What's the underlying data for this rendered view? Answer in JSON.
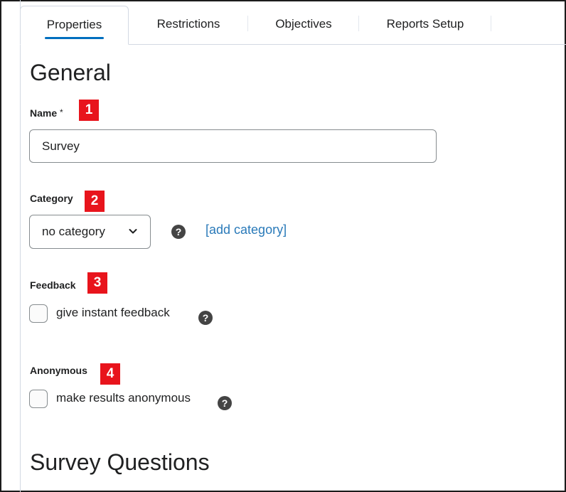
{
  "tabs": [
    {
      "label": "Properties",
      "active": true
    },
    {
      "label": "Restrictions",
      "active": false
    },
    {
      "label": "Objectives",
      "active": false
    },
    {
      "label": "Reports Setup",
      "active": false
    }
  ],
  "general": {
    "heading": "General",
    "name": {
      "label": "Name",
      "required_mark": "*",
      "marker": "1",
      "value": "Survey"
    },
    "category": {
      "label": "Category",
      "marker": "2",
      "selected": "no category",
      "help_icon": "?",
      "add_link": "[add category]"
    },
    "feedback": {
      "label": "Feedback",
      "marker": "3",
      "checkbox_label": "give instant feedback",
      "checked": false,
      "help_icon": "?"
    },
    "anonymous": {
      "label": "Anonymous",
      "marker": "4",
      "checkbox_label": "make results anonymous",
      "checked": false,
      "help_icon": "?"
    }
  },
  "survey_questions": {
    "heading": "Survey Questions"
  },
  "colors": {
    "accent": "#006fbf",
    "link": "#2a7ab9",
    "marker": "#e8141c",
    "border": "#868c8f"
  }
}
